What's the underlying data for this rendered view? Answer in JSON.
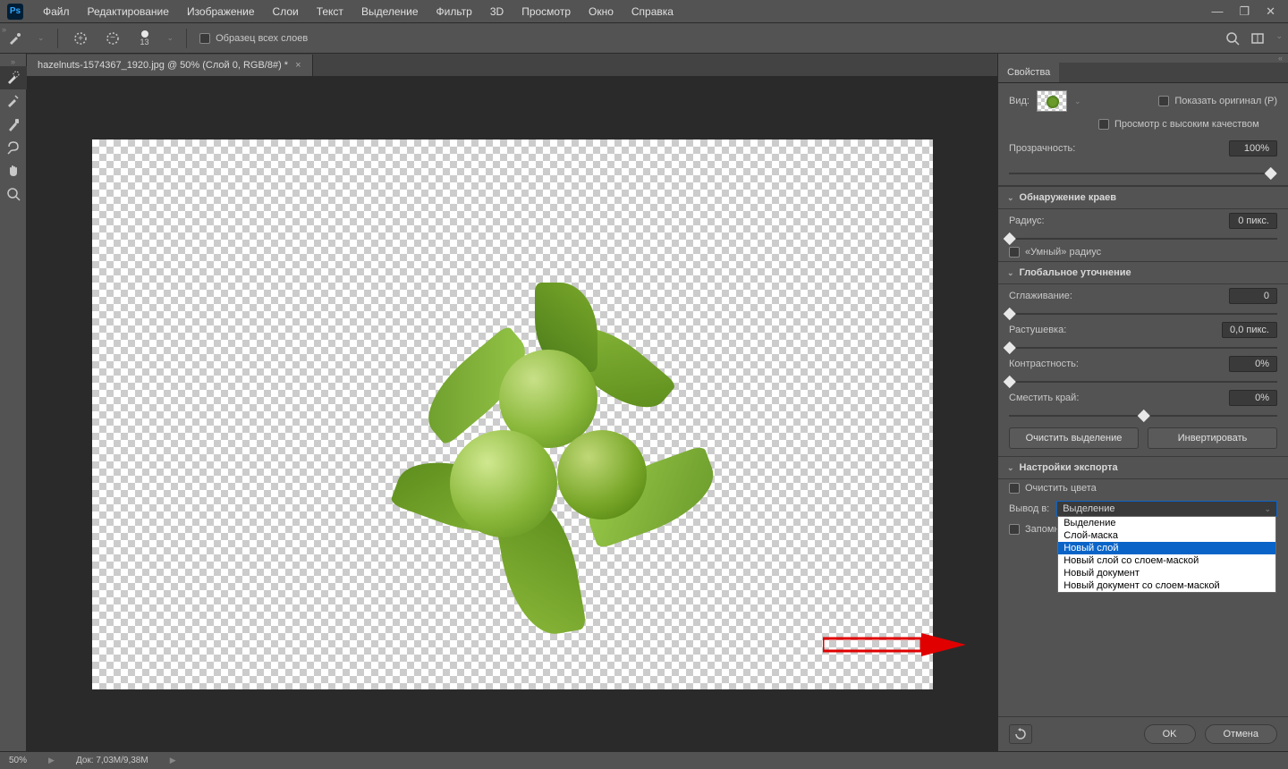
{
  "menu": {
    "items": [
      "Файл",
      "Редактирование",
      "Изображение",
      "Слои",
      "Текст",
      "Выделение",
      "Фильтр",
      "3D",
      "Просмотр",
      "Окно",
      "Справка"
    ]
  },
  "optionsbar": {
    "brush_size": "13",
    "sample_all_layers_label": "Образец всех слоев"
  },
  "document": {
    "tab_title": "hazelnuts-1574367_1920.jpg @ 50% (Слой 0, RGB/8#) *"
  },
  "status": {
    "zoom": "50%",
    "docinfo": "Док: 7,03M/9,38M"
  },
  "panel": {
    "title": "Свойства",
    "view_label": "Вид:",
    "show_original_label": "Показать оригинал (P)",
    "high_quality_label": "Просмотр с высоким качеством",
    "opacity_label": "Прозрачность:",
    "opacity_value": "100%",
    "edge_detection_title": "Обнаружение краев",
    "radius_label": "Радиус:",
    "radius_value": "0 пикс.",
    "smart_radius_label": "«Умный» радиус",
    "global_refine_title": "Глобальное уточнение",
    "smooth_label": "Сглаживание:",
    "smooth_value": "0",
    "feather_label": "Растушевка:",
    "feather_value": "0,0 пикс.",
    "contrast_label": "Контрастность:",
    "contrast_value": "0%",
    "shift_edge_label": "Сместить край:",
    "shift_edge_value": "0%",
    "clear_selection_btn": "Очистить выделение",
    "invert_btn": "Инвертировать",
    "output_settings_title": "Настройки экспорта",
    "decontaminate_label": "Очистить цвета",
    "output_to_label": "Вывод в:",
    "output_selected": "Выделение",
    "output_options": [
      "Выделение",
      "Слой-маска",
      "Новый слой",
      "Новый слой со слоем-маской",
      "Новый документ",
      "Новый документ со слоем-маской"
    ],
    "output_highlighted_index": 2,
    "remember_label": "Запомн",
    "ok_btn": "OK",
    "cancel_btn": "Отмена"
  }
}
